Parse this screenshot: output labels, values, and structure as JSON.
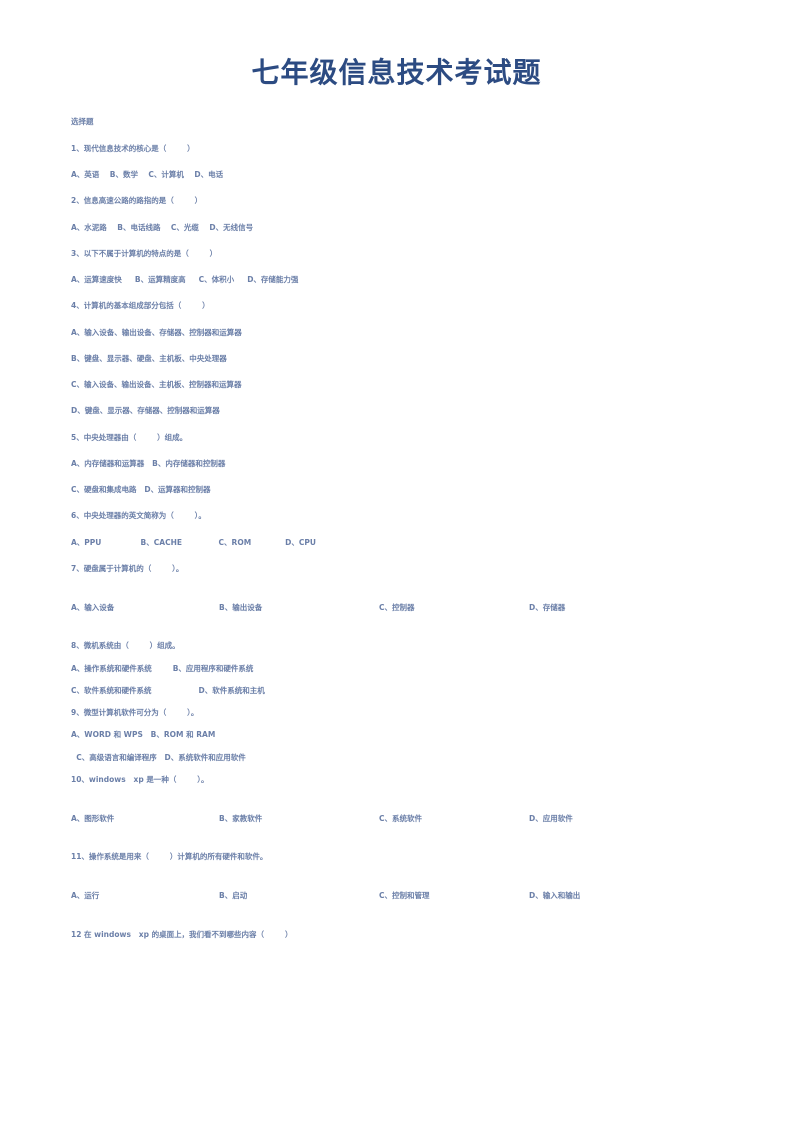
{
  "document": {
    "title": "七年级信息技术考试题",
    "title_color": "#2c4b82",
    "body_color": "#6b7fa8",
    "section_heading": "选择题"
  },
  "questions": [
    {
      "stem": "1、现代信息技术的核心是（        ）",
      "options_layout": "inline",
      "options": [
        "A、英语",
        "B、数学",
        "C、计算机",
        "D、电话"
      ],
      "option_line": "A、英语    B、数学    C、计算机    D、电话"
    },
    {
      "stem": "2、信息高速公路的路指的是（        ）",
      "options_layout": "inline",
      "options": [
        "A、水泥路",
        "B、电话线路",
        "C、光缆",
        "D、无线信号"
      ],
      "option_line": "A、水泥路    B、电话线路    C、光缆    D、无线信号"
    },
    {
      "stem": "3、以下不属于计算机的特点的是（        ）",
      "options_layout": "inline",
      "options": [
        "A、运算速度快",
        "B、运算精度高",
        "C、体积小",
        "D、存储能力强"
      ],
      "option_line": "A、运算速度快     B、运算精度高     C、体积小     D、存储能力强"
    },
    {
      "stem": "4、计算机的基本组成部分包括（        ）",
      "options_layout": "stacked",
      "options": [
        "A、输入设备、输出设备、存储器、控制器和运算器",
        "B、键盘、显示器、硬盘、主机板、中央处理器",
        "C、输入设备、输出设备、主机板、控制器和运算器",
        "D、键盘、显示器、存储器、控制器和运算器"
      ]
    },
    {
      "stem": "5、中央处理器由（        ）组成。",
      "options_layout": "paired",
      "option_rows": [
        "A、内存储器和运算器   B、内存储器和控制器",
        "C、硬盘和集成电路   D、运算器和控制器"
      ]
    },
    {
      "stem": "6、中央处理器的英文简称为（        ）。",
      "options_layout": "inline",
      "options": [
        "A、PPU",
        "B、CACHE",
        "C、ROM",
        "D、CPU"
      ],
      "option_line": "A、PPU               B、CACHE              C、ROM             D、CPU"
    },
    {
      "stem": "7、硬盘属于计算机的（        ）。",
      "options_layout": "spread",
      "options": [
        "A、输入设备",
        "B、输出设备",
        "C、控制器",
        "D、存储器"
      ]
    },
    {
      "stem": "8、微机系统由（        ）组成。",
      "options_layout": "paired",
      "option_rows": [
        "A、操作系统和硬件系统        B、应用程序和硬件系统",
        "C、软件系统和硬件系统                  D、软件系统和主机"
      ]
    },
    {
      "stem": "9、微型计算机软件可分为（        ）。",
      "options_layout": "paired-indent",
      "option_rows": [
        "A、WORD 和 WPS   B、ROM 和 RAM",
        "  C、高级语言和编译程序   D、系统软件和应用软件"
      ]
    },
    {
      "stem": "10、windows   xp 是一种（        ）。",
      "options_layout": "spread",
      "options": [
        "A、图形软件",
        "B、家教软件",
        "C、系统软件",
        "D、应用软件"
      ]
    },
    {
      "stem": "11、操作系统是用来（        ）计算机的所有硬件和软件。",
      "options_layout": "spread",
      "options": [
        "A、运行",
        "B、启动",
        "C、控制和管理",
        "D、输入和输出"
      ]
    },
    {
      "stem": "12 在 windows   xp 的桌面上，我们看不到哪些内容（        ）",
      "options_layout": "none",
      "options": []
    }
  ]
}
